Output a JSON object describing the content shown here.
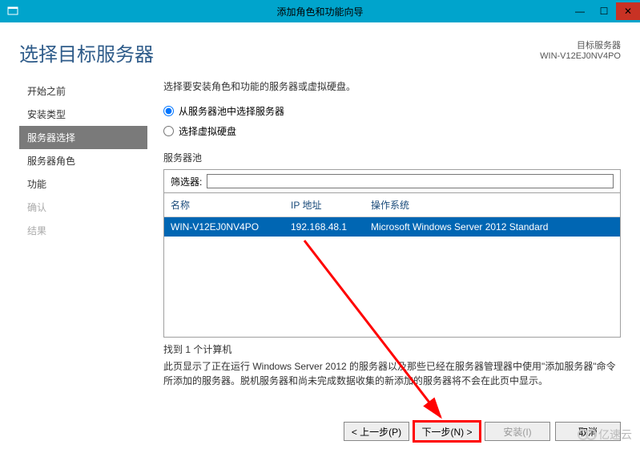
{
  "window": {
    "title": "添加角色和功能向导"
  },
  "header": {
    "page_title": "选择目标服务器",
    "target_label": "目标服务器",
    "target_name": "WIN-V12EJ0NV4PO"
  },
  "nav": {
    "items": [
      {
        "label": "开始之前"
      },
      {
        "label": "安装类型"
      },
      {
        "label": "服务器选择"
      },
      {
        "label": "服务器角色"
      },
      {
        "label": "功能"
      },
      {
        "label": "确认"
      },
      {
        "label": "结果"
      }
    ]
  },
  "main": {
    "instruction": "选择要安装角色和功能的服务器或虚拟硬盘。",
    "radio_pool": "从服务器池中选择服务器",
    "radio_vhd": "选择虚拟硬盘",
    "pool_title": "服务器池",
    "filter_label": "筛选器:",
    "filter_value": "",
    "columns": {
      "name": "名称",
      "ip": "IP 地址",
      "os": "操作系统"
    },
    "rows": [
      {
        "name": "WIN-V12EJ0NV4PO",
        "ip": "192.168.48.1",
        "os": "Microsoft Windows Server 2012 Standard"
      }
    ],
    "found_text": "找到 1 个计算机",
    "description": "此页显示了正在运行 Windows Server 2012 的服务器以及那些已经在服务器管理器中使用\"添加服务器\"命令所添加的服务器。脱机服务器和尚未完成数据收集的新添加的服务器将不会在此页中显示。"
  },
  "footer": {
    "prev": "< 上一步(P)",
    "next": "下一步(N) >",
    "install": "安装(I)",
    "cancel": "取消"
  },
  "watermark": "亿速云"
}
